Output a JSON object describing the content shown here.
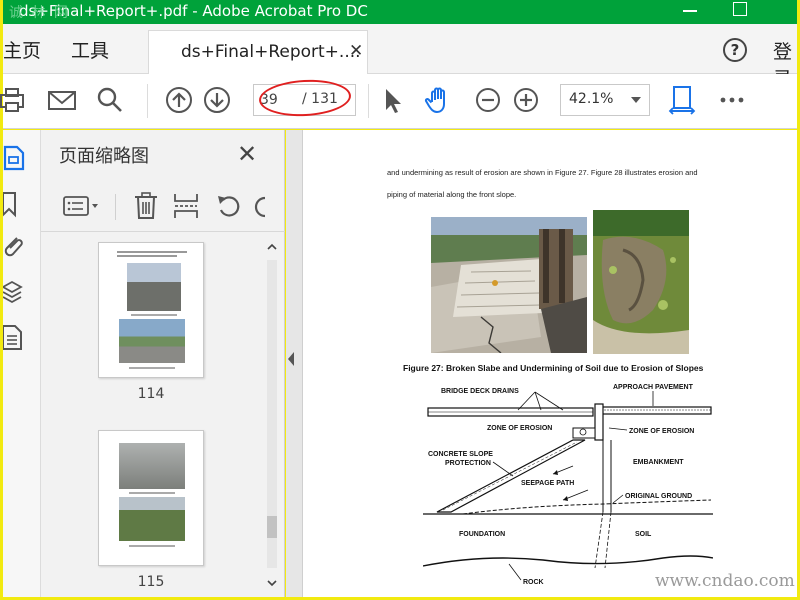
{
  "window": {
    "title": "ds+Final+Report+.pdf - Adobe Acrobat Pro DC",
    "watermark_text": "诚 林 网"
  },
  "tabs": {
    "home": "主页",
    "tools": "工具",
    "document_tab": "ds+Final+Report+....",
    "login": "登录"
  },
  "toolbar": {
    "current_page": "39",
    "total_pages": "/ 131",
    "zoom": "42.1%",
    "icons": [
      "print-icon",
      "email-icon",
      "search-icon",
      "page-up-icon",
      "page-down-icon",
      "select-arrow-icon",
      "hand-icon",
      "zoom-out-icon",
      "zoom-in-icon",
      "fit-page-icon",
      "more-icon"
    ]
  },
  "thumbnail_panel": {
    "title": "页面缩略图",
    "pages": [
      {
        "number": "114"
      },
      {
        "number": "115"
      }
    ]
  },
  "document": {
    "line1": "and undermining as result of erosion are shown in Figure 27. Figure 28 illustrates erosion and",
    "line2": "piping of material along the front slope.",
    "caption": "Figure 27:  Broken Slabe and Undermining of Soil due to Erosion of Slopes",
    "diagram_labels": {
      "bridge_deck_drains": "BRIDGE DECK DRAINS",
      "approach_pavement": "APPROACH PAVEMENT",
      "zone_of_erosion_1": "ZONE OF EROSION",
      "zone_of_erosion_2": "ZONE OF EROSION",
      "concrete_slope": "CONCRETE SLOPE",
      "protection": "PROTECTION",
      "embankment": "EMBANKMENT",
      "seepage_path": "SEEPAGE PATH",
      "original_ground": "ORIGINAL GROUND",
      "foundation": "FOUNDATION",
      "soil": "SOIL",
      "rock": "ROCK"
    }
  },
  "site_watermark": "www.cndao.com",
  "colors": {
    "title_bar": "#00a23a",
    "frame": "#f2ea10",
    "annotation_ellipse": "#e02020"
  }
}
